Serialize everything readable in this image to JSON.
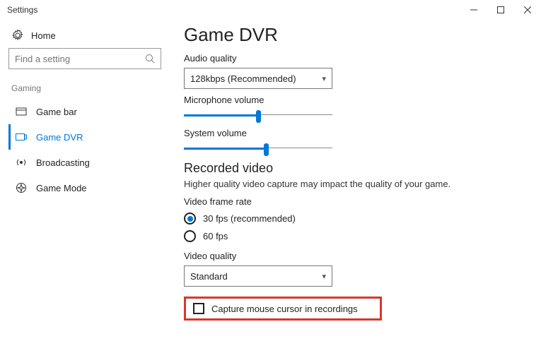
{
  "window": {
    "title": "Settings"
  },
  "sidebar": {
    "home": "Home",
    "search_placeholder": "Find a setting",
    "section": "Gaming",
    "items": [
      {
        "label": "Game bar"
      },
      {
        "label": "Game DVR"
      },
      {
        "label": "Broadcasting"
      },
      {
        "label": "Game Mode"
      }
    ]
  },
  "page": {
    "heading": "Game DVR",
    "audio_quality_label": "Audio quality",
    "audio_quality_value": "128kbps (Recommended)",
    "microphone_label": "Microphone volume",
    "microphone_value": 50,
    "system_label": "System volume",
    "system_value": 55,
    "recorded_heading": "Recorded video",
    "recorded_sub": "Higher quality video capture may impact the quality of your game.",
    "frame_rate_label": "Video frame rate",
    "frame_rate_options": [
      {
        "label": "30 fps (recommended)",
        "selected": true
      },
      {
        "label": "60 fps",
        "selected": false
      }
    ],
    "video_quality_label": "Video quality",
    "video_quality_value": "Standard",
    "capture_cursor_label": "Capture mouse cursor in recordings",
    "capture_cursor_checked": false
  }
}
